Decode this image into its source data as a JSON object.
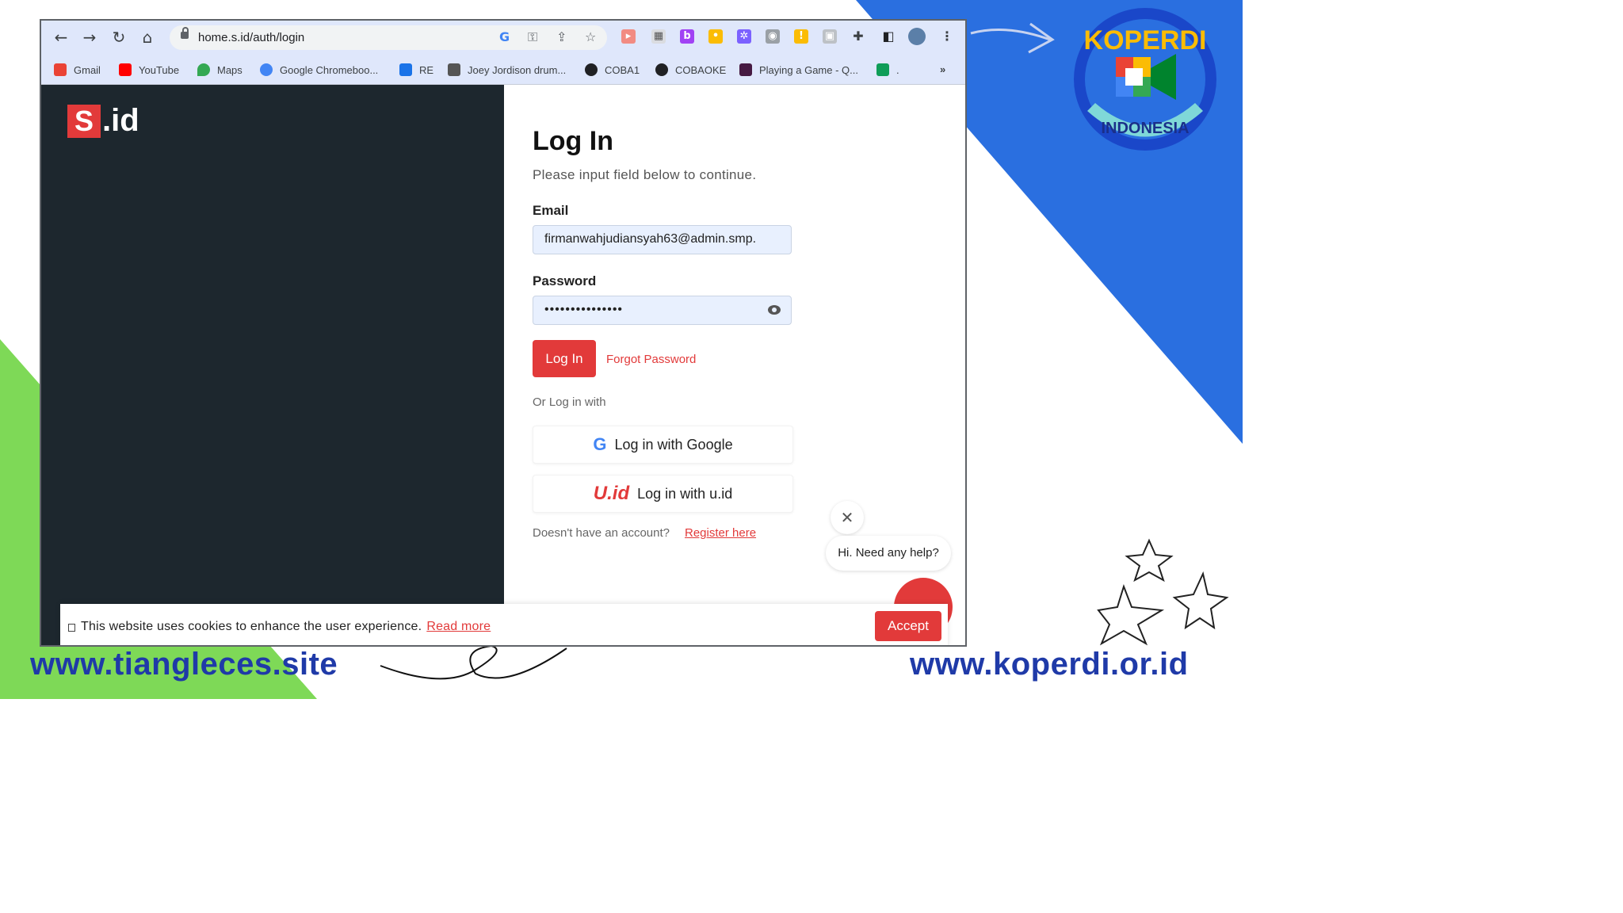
{
  "browser": {
    "url": "home.s.id/auth/login",
    "bookmarks": [
      {
        "label": "Gmail",
        "icon": "gmail-icon",
        "color": "#ea4335"
      },
      {
        "label": "YouTube",
        "icon": "youtube-icon",
        "color": "#ff0000"
      },
      {
        "label": "Maps",
        "icon": "maps-icon",
        "color": "#34a853"
      },
      {
        "label": "Google Chromeboo...",
        "icon": "google-icon",
        "color": "#4285f4"
      },
      {
        "label": "RE",
        "icon": "contact-icon",
        "color": "#1a73e8"
      },
      {
        "label": "Joey Jordison drum...",
        "icon": "video-icon",
        "color": "#555555"
      },
      {
        "label": "COBA1",
        "icon": "globe-icon",
        "color": "#202124"
      },
      {
        "label": "COBAOKE",
        "icon": "globe-icon",
        "color": "#202124"
      },
      {
        "label": "Playing a Game - Q...",
        "icon": "quizizz-icon",
        "color": "#461a42"
      },
      {
        "label": ".",
        "icon": "sheets-icon",
        "color": "#0f9d58"
      }
    ]
  },
  "site": {
    "logo_s": "S",
    "logo_id": ".id"
  },
  "login": {
    "title": "Log In",
    "subtitle": "Please input field below to continue.",
    "email_label": "Email",
    "email_value": "firmanwahjudiansyah63@admin.smp.",
    "password_label": "Password",
    "password_value": "•••••••••••••••",
    "login_button": "Log In",
    "forgot_link": "Forgot Password",
    "or_text": "Or Log in with",
    "google_button": "Log in with Google",
    "uid_button": "Log in with u.id",
    "uid_logo": "U.id",
    "google_logo": "G",
    "no_account_text": "Doesn't have an account?",
    "register_link": "Register here"
  },
  "chat": {
    "bubble_text": "Hi. Need any help?"
  },
  "cookie": {
    "text": "This website uses cookies to enhance the user experience.",
    "read_more": "Read more",
    "accept": "Accept"
  },
  "overlay": {
    "footer_left": "www.tiangleces.site",
    "footer_right": "www.koperdi.or.id",
    "badge_top": "KOPERDI",
    "badge_bottom": "INDONESIA"
  },
  "colors": {
    "accent_red": "#e23a3a",
    "dark_panel": "#1d272e",
    "deco_blue": "#2a6fe0",
    "deco_green": "#7ed957",
    "footer_text": "#1f3aa8"
  }
}
